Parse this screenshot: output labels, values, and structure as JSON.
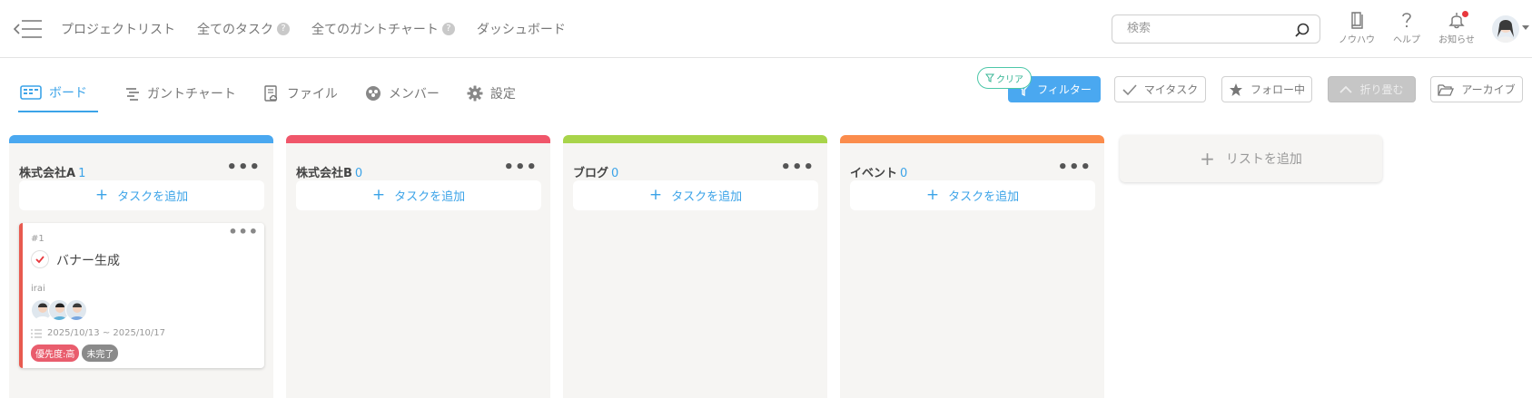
{
  "nav": {
    "items": [
      {
        "label": "プロジェクトリスト",
        "help": false
      },
      {
        "label": "全てのタスク",
        "help": true
      },
      {
        "label": "全てのガントチャート",
        "help": true
      },
      {
        "label": "ダッシュボード",
        "help": false
      }
    ],
    "help_glyph": "?"
  },
  "search": {
    "placeholder": "検索"
  },
  "top_tools": {
    "knowhow": "ノウハウ",
    "help": "ヘルプ",
    "notifications": "お知らせ"
  },
  "tabs": [
    {
      "label": "ボード",
      "active": true
    },
    {
      "label": "ガントチャート",
      "active": false
    },
    {
      "label": "ファイル",
      "active": false
    },
    {
      "label": "メンバー",
      "active": false
    },
    {
      "label": "設定",
      "active": false
    }
  ],
  "toolbar": {
    "clear": "クリア",
    "filter": "フィルター",
    "my_task": "マイタスク",
    "following": "フォロー中",
    "collapse": "折り畳む",
    "archive": "アーカイブ"
  },
  "colors": {
    "accent": "#3ba3e8",
    "list_a": "#4aa8f0",
    "list_b": "#f0566a",
    "list_blog": "#a8d44a",
    "list_event": "#fb8c4c"
  },
  "lists": [
    {
      "title": "株式会社A",
      "count": "1",
      "add_task": "タスクを追加"
    },
    {
      "title": "株式会社B",
      "count": "0",
      "add_task": "タスクを追加"
    },
    {
      "title": "ブログ",
      "count": "0",
      "add_task": "タスクを追加"
    },
    {
      "title": "イベント",
      "count": "0",
      "add_task": "タスクを追加"
    }
  ],
  "card": {
    "id": "#1",
    "title": "バナー生成",
    "assignee": "irai",
    "dates": "2025/10/13 ~ 2025/10/17",
    "tags": {
      "priority": "優先度:高",
      "status": "未完了"
    }
  },
  "add_list": {
    "label": "リストを追加"
  },
  "ellipsis": "•••"
}
